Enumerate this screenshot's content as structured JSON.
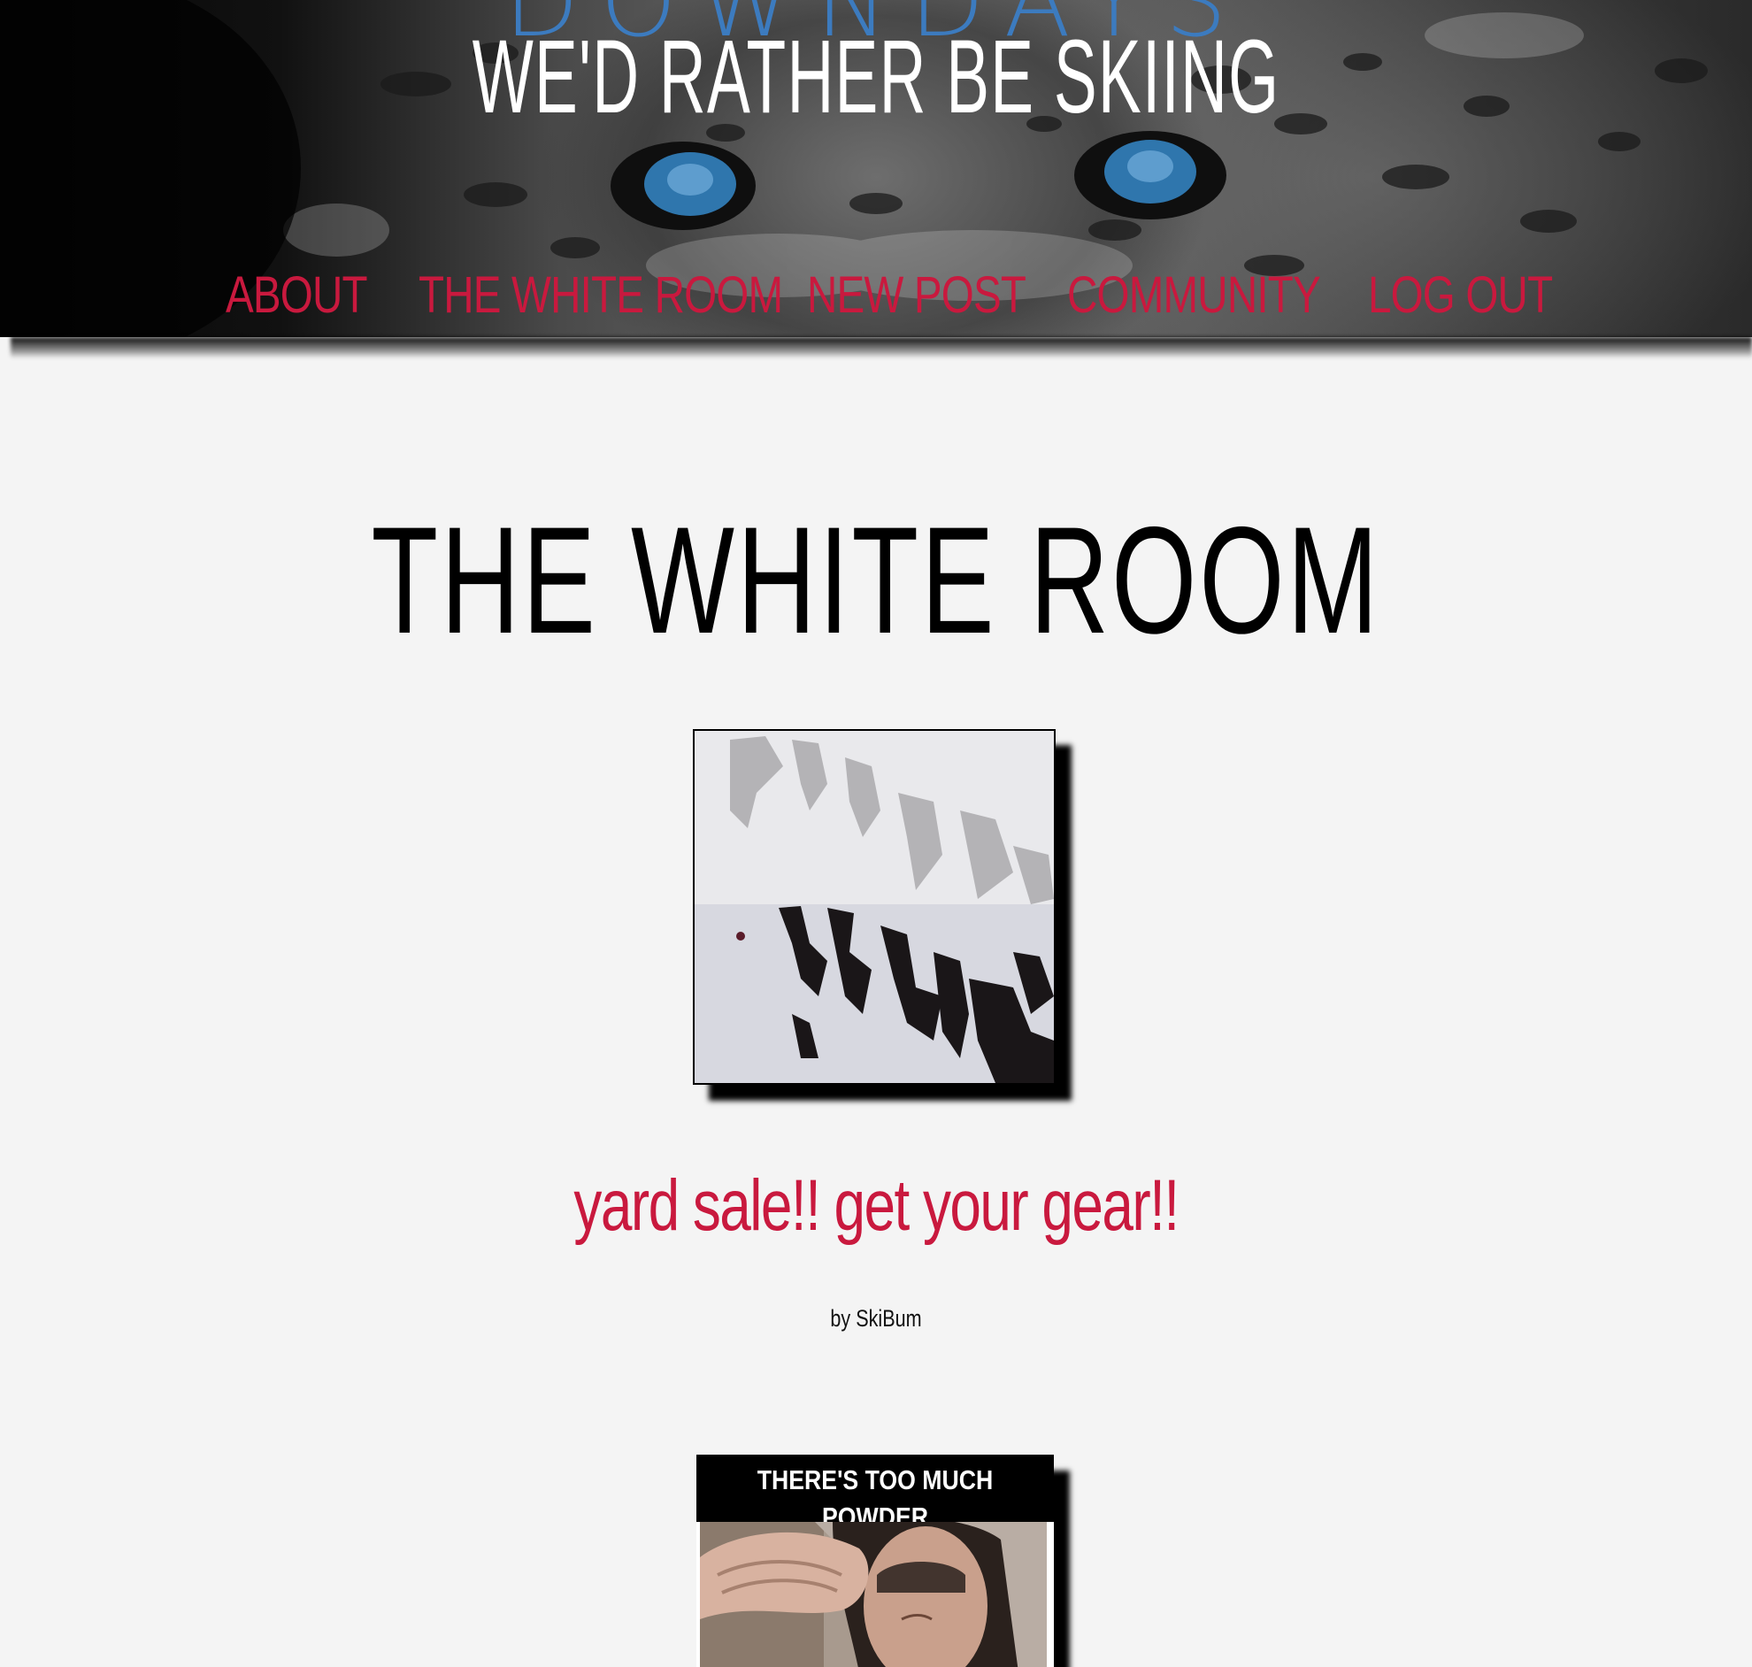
{
  "header": {
    "brand": "DOWNDAYS",
    "tagline": "WE'D RATHER BE SKIING",
    "nav": [
      {
        "label": "ABOUT"
      },
      {
        "label": "THE WHITE ROOM"
      },
      {
        "label": "NEW POST"
      },
      {
        "label": "COMMUNITY"
      },
      {
        "label": "LOG OUT"
      }
    ]
  },
  "main": {
    "page_title": "THE WHITE ROOM",
    "posts": [
      {
        "title": "yard sale!! get your gear!!",
        "byline": "by SkiBum"
      }
    ],
    "meme": {
      "caption": "THERE'S TOO MUCH\nPOWDER"
    }
  },
  "colors": {
    "accent": "#c9193e",
    "brand_blue": "#3c7bbf",
    "background": "#f4f4f4"
  }
}
